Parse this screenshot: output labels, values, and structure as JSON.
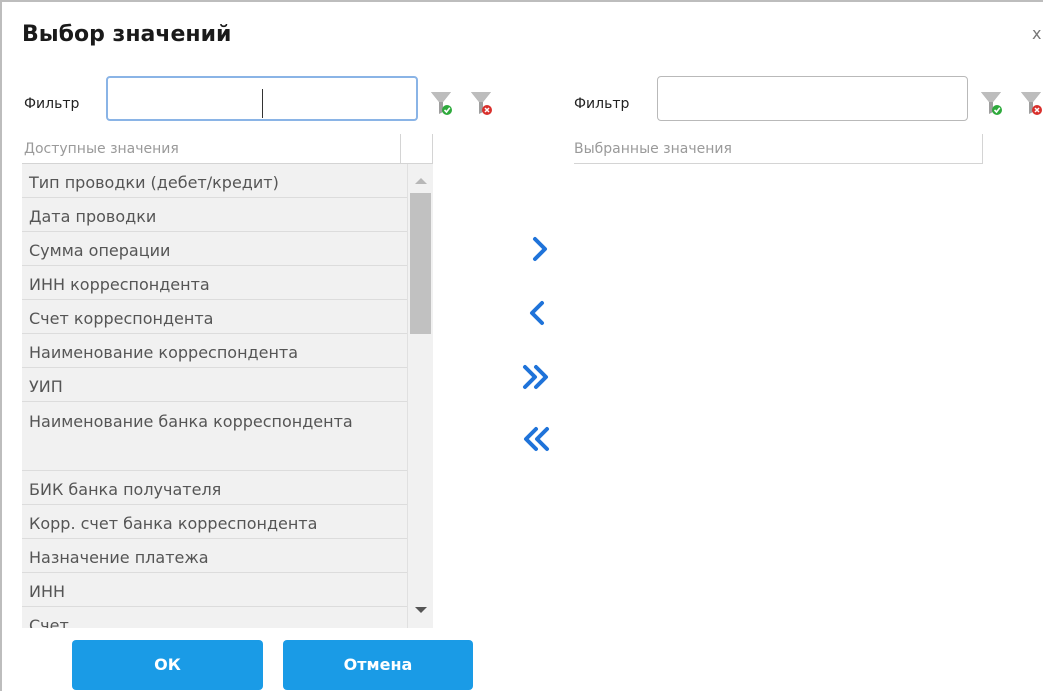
{
  "dialog": {
    "title": "Выбор значений",
    "close_glyph": "x"
  },
  "left": {
    "filter_label": "Фильтр",
    "filter_value": "",
    "header": "Доступные значения",
    "items": [
      {
        "label": "Тип проводки (дебет/кредит)"
      },
      {
        "label": "Дата проводки"
      },
      {
        "label": "Сумма операции"
      },
      {
        "label": "ИНН корреспондента"
      },
      {
        "label": "Счет корреспондента"
      },
      {
        "label": "Наименование корреспондента"
      },
      {
        "label": "УИП"
      },
      {
        "label": "Наименование банка корреспондента"
      },
      {
        "label": "БИК банка получателя"
      },
      {
        "label": "Корр. счет банка корреспондента"
      },
      {
        "label": "Назначение платежа"
      },
      {
        "label": "ИНН"
      },
      {
        "label": "Счет"
      }
    ]
  },
  "right": {
    "filter_label": "Фильтр",
    "filter_value": "",
    "header": "Выбранные значения"
  },
  "icons": {
    "apply_filter": "funnel-check-icon",
    "clear_filter": "funnel-clear-icon",
    "move_right": "chevron-right-icon",
    "move_left": "chevron-left-icon",
    "move_all_right": "double-chevron-right-icon",
    "move_all_left": "double-chevron-left-icon"
  },
  "colors": {
    "accent": "#1a9be6",
    "arrow": "#1f73d9",
    "row_bg": "#f1f1f1"
  },
  "buttons": {
    "ok": "ОК",
    "cancel": "Отмена"
  }
}
